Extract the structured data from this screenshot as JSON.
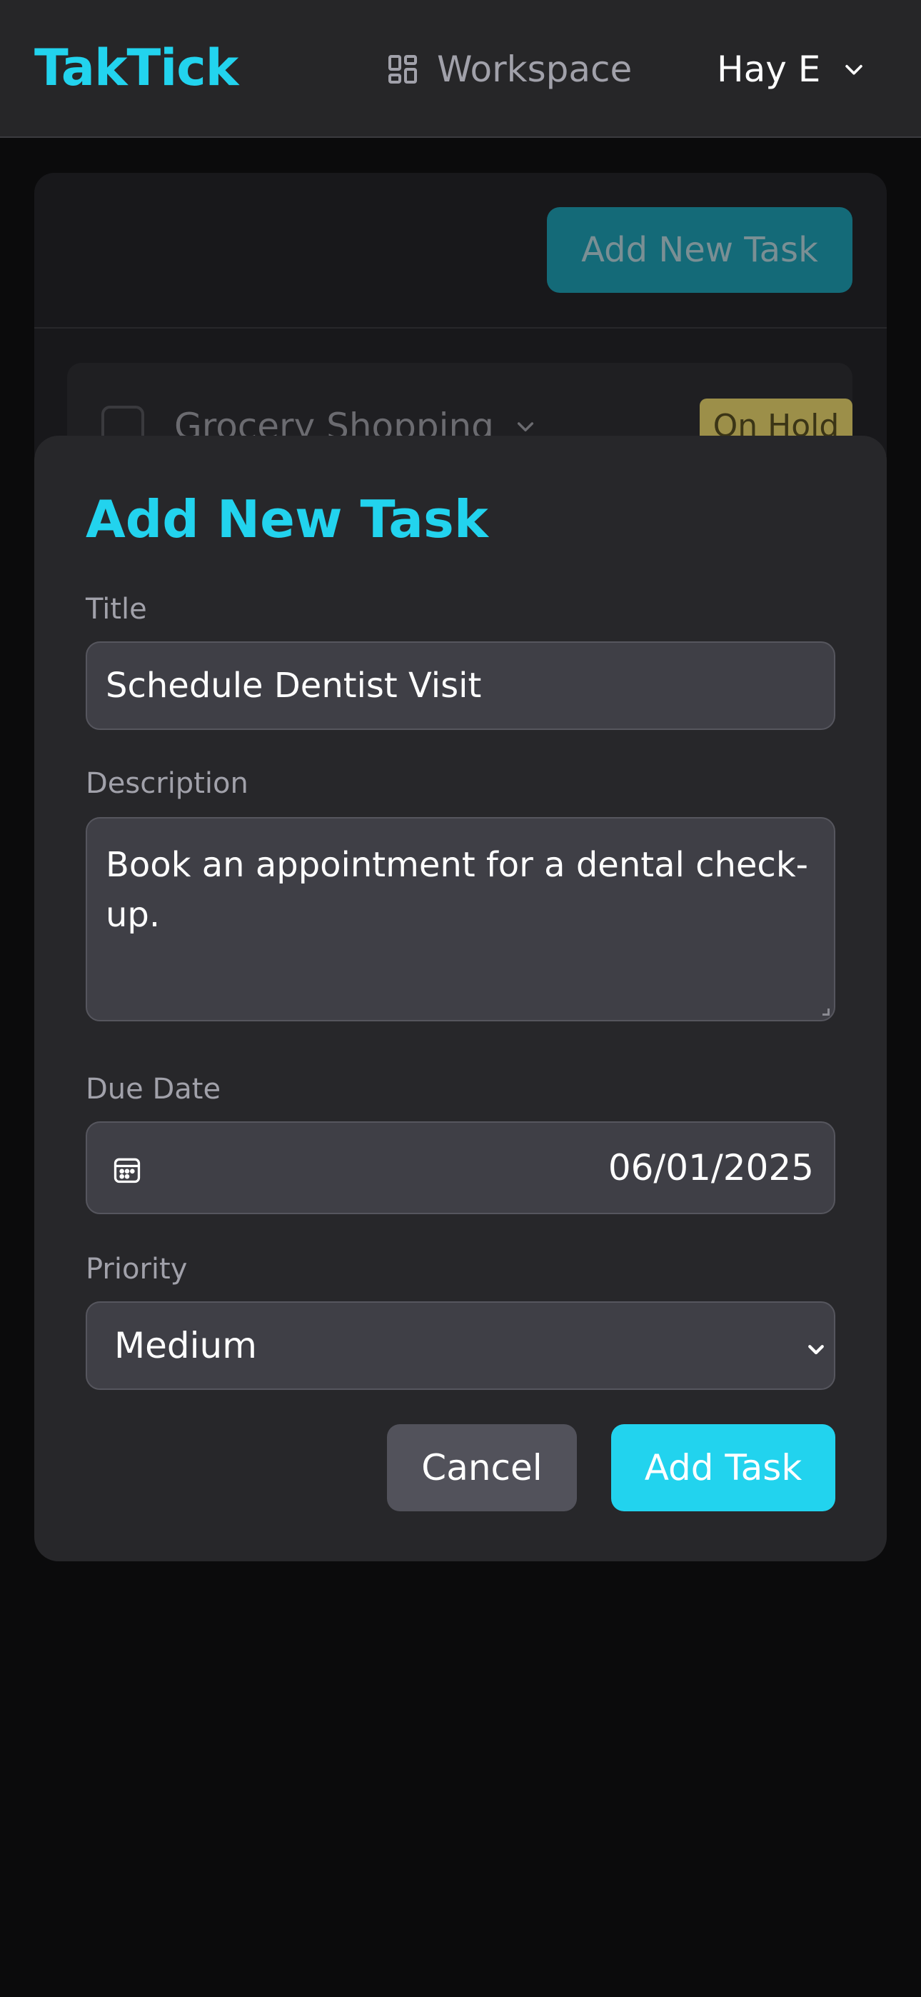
{
  "header": {
    "logo": "TakTick",
    "workspace_label": "Workspace",
    "workspace_icon": "dashboard-grid-icon",
    "user_name": "Hay E",
    "user_menu_icon": "chevron-down-icon"
  },
  "background_page": {
    "add_button_label": "Add New Task",
    "task": {
      "title": "Grocery Shopping",
      "status_badge": "On Hold"
    }
  },
  "modal": {
    "title": "Add New Task",
    "fields": {
      "title": {
        "label": "Title",
        "value": "Schedule Dentist Visit"
      },
      "description": {
        "label": "Description",
        "value": "Book an appointment for a dental check-up."
      },
      "due_date": {
        "label": "Due Date",
        "value": "06/01/2025",
        "icon": "calendar-icon"
      },
      "priority": {
        "label": "Priority",
        "value": "Medium"
      }
    },
    "buttons": {
      "cancel": "Cancel",
      "submit": "Add Task"
    }
  },
  "colors": {
    "accent": "#22d3ee",
    "page_bg": "#0b0b0c",
    "modal_bg": "#27272a",
    "input_bg": "#3f3f46",
    "badge_on_hold": "#9c8f49"
  }
}
